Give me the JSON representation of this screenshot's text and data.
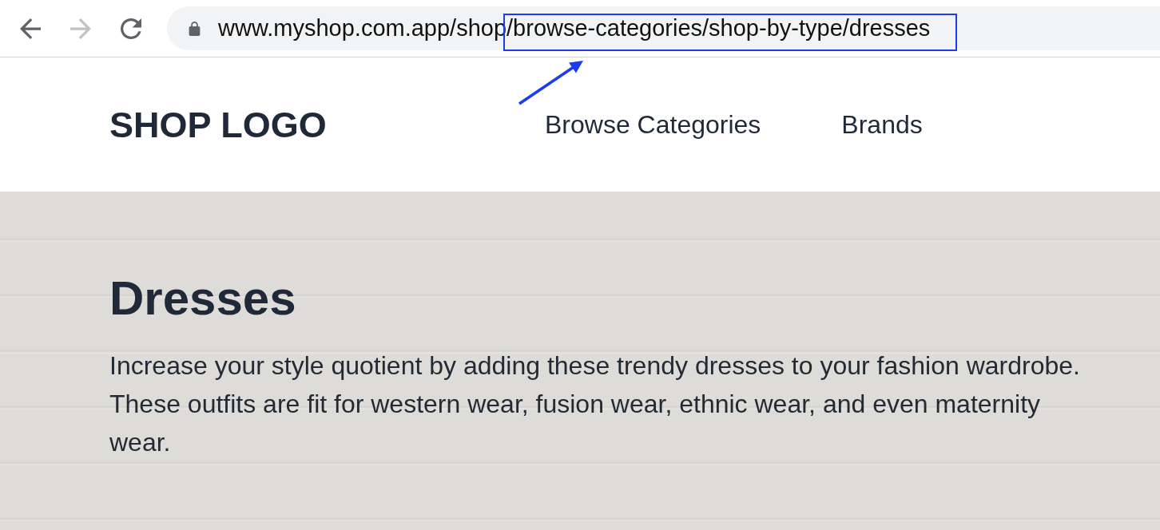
{
  "browser": {
    "nav_buttons": [
      {
        "kind": "back",
        "disabled": false
      },
      {
        "kind": "forward",
        "disabled": true
      },
      {
        "kind": "reload",
        "disabled": false
      }
    ],
    "address_bar": {
      "secure": true,
      "url_parts": [
        {
          "text": "www.myshop.com.app/shop",
          "highlighted": false
        },
        {
          "text": "/browse-categories/shop-by-type/dresses",
          "highlighted": true
        }
      ]
    }
  },
  "header": {
    "logo": "SHOP LOGO",
    "nav": [
      "Browse Categories",
      "Brands"
    ]
  },
  "hero": {
    "title": "Dresses",
    "description": "Increase your style quotient by adding these trendy dresses to your fashion wardrobe. These outfits are fit for western wear, fusion wear, ethnic wear, and even maternity wear."
  }
}
